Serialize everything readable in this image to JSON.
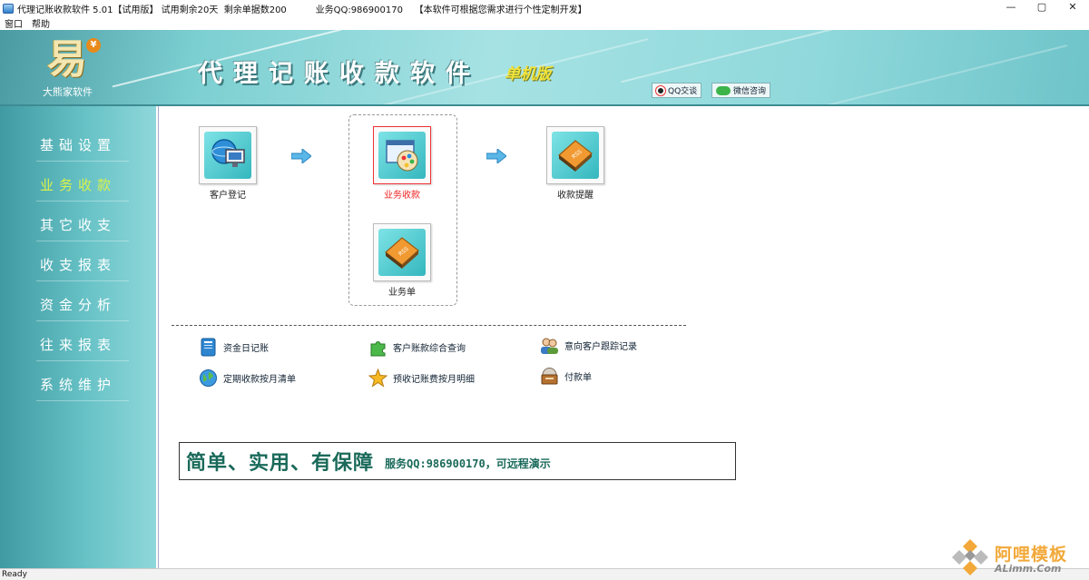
{
  "window": {
    "title": "代理记账收款软件 5.01【试用版】 试用剩余20天  剩余单据数200          业务QQ:986900170    【本软件可根据您需求进行个性定制开发】",
    "minimize": "—",
    "maximize": "▢",
    "close": "✕"
  },
  "menu": {
    "items": [
      "窗口",
      "帮助"
    ]
  },
  "banner": {
    "logo_char": "易",
    "logo_coin": "¥",
    "company": "大熊家软件",
    "app_title": "代理记账收款软件",
    "edition": "单机版",
    "qq_chip": "QQ交谈",
    "wechat_chip": "微信咨询"
  },
  "sidebar": {
    "items": [
      {
        "label": "基础设置",
        "active": false
      },
      {
        "label": "业务收款",
        "active": true
      },
      {
        "label": "其它收支",
        "active": false
      },
      {
        "label": "收支报表",
        "active": false
      },
      {
        "label": "资金分析",
        "active": false
      },
      {
        "label": "往来报表",
        "active": false
      },
      {
        "label": "系统维护",
        "active": false
      }
    ]
  },
  "workflow": {
    "customer_register": "客户登记",
    "business_receipt": "业务收款",
    "receipt_reminder": "收款提醒",
    "business_order": "业务单"
  },
  "links": {
    "cash_journal": "资金日记账",
    "customer_query": "客户账款综合查询",
    "prospect_tracking": "意向客户跟踪记录",
    "periodic_receipt": "定期收款按月清单",
    "prepaid_detail": "预收记账费按月明细",
    "payment_order": "付款单"
  },
  "slogan": {
    "main": "简单、实用、有保障",
    "sub": "服务QQ:986900170，可远程演示"
  },
  "status": {
    "text": "Ready"
  },
  "watermark": {
    "text": "阿哩模板",
    "sub": "ALimm.Com"
  }
}
